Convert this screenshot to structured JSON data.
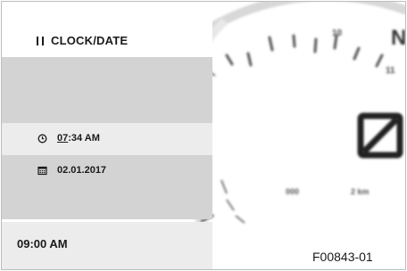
{
  "header": {
    "title": "CLOCK/DATE",
    "icon": "pause-icon"
  },
  "time_row": {
    "icon": "clock-icon",
    "hour": "07",
    "rest": ":34 AM"
  },
  "date_row": {
    "icon": "calendar-icon",
    "value": "02.01.2017"
  },
  "footer": {
    "time": "09:00 AM"
  },
  "figure_id": "F00843-01",
  "colors": {
    "panel_gray": "#d3d3d3",
    "panel_light": "#ececec",
    "text": "#1a1a1a",
    "gauge_blur": "#bdbdbd"
  }
}
